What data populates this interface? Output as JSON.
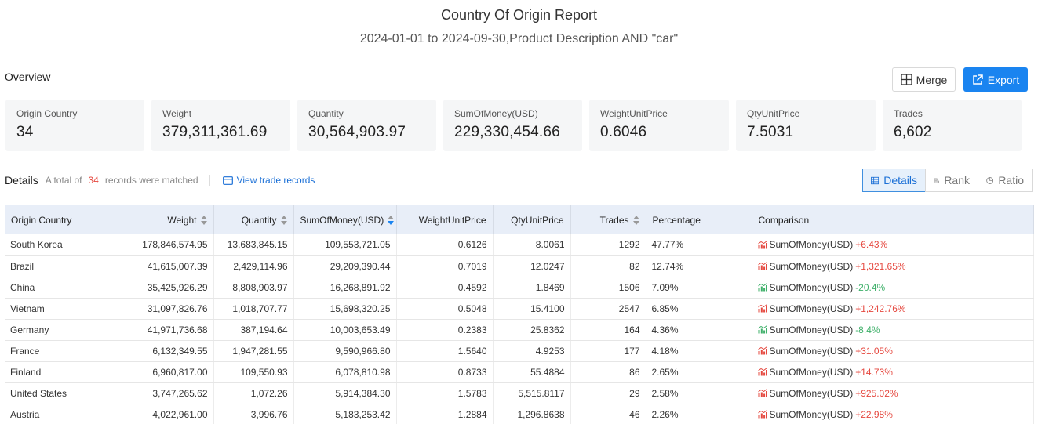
{
  "header": {
    "title": "Country Of Origin Report",
    "subtitle": "2024-01-01 to 2024-09-30,Product Description AND \"car\""
  },
  "overview": {
    "label": "Overview",
    "merge_label": "Merge",
    "export_label": "Export",
    "stats": [
      {
        "label": "Origin Country",
        "value": "34"
      },
      {
        "label": "Weight",
        "value": "379,311,361.69"
      },
      {
        "label": "Quantity",
        "value": "30,564,903.97"
      },
      {
        "label": "SumOfMoney(USD)",
        "value": "229,330,454.66"
      },
      {
        "label": "WeightUnitPrice",
        "value": "0.6046"
      },
      {
        "label": "QtyUnitPrice",
        "value": "7.5031"
      },
      {
        "label": "Trades",
        "value": "6,602"
      }
    ]
  },
  "details": {
    "title": "Details",
    "info_prefix": "A total of",
    "count": "34",
    "info_suffix": "records were matched",
    "view_trade": "View trade records",
    "views": [
      "Details",
      "Rank",
      "Ratio"
    ],
    "active_view": "Details"
  },
  "table": {
    "headers": [
      "Origin Country",
      "Weight",
      "Quantity",
      "SumOfMoney(USD)",
      "WeightUnitPrice",
      "QtyUnitPrice",
      "Trades",
      "Percentage",
      "Comparison"
    ],
    "comparison_label": "SumOfMoney(USD)",
    "rows": [
      {
        "country": "South Korea",
        "weight": "178,846,574.95",
        "quantity": "13,683,845.15",
        "money": "109,553,721.05",
        "wup": "0.6126",
        "qup": "8.0061",
        "trades": "1292",
        "pct": "47.77%",
        "change": "+6.43%",
        "dir": "up"
      },
      {
        "country": "Brazil",
        "weight": "41,615,007.39",
        "quantity": "2,429,114.96",
        "money": "29,209,390.44",
        "wup": "0.7019",
        "qup": "12.0247",
        "trades": "82",
        "pct": "12.74%",
        "change": "+1,321.65%",
        "dir": "up"
      },
      {
        "country": "China",
        "weight": "35,425,926.29",
        "quantity": "8,808,903.97",
        "money": "16,268,891.92",
        "wup": "0.4592",
        "qup": "1.8469",
        "trades": "1506",
        "pct": "7.09%",
        "change": "-20.4%",
        "dir": "down"
      },
      {
        "country": "Vietnam",
        "weight": "31,097,826.76",
        "quantity": "1,018,707.77",
        "money": "15,698,320.25",
        "wup": "0.5048",
        "qup": "15.4100",
        "trades": "2547",
        "pct": "6.85%",
        "change": "+1,242.76%",
        "dir": "up"
      },
      {
        "country": "Germany",
        "weight": "41,971,736.68",
        "quantity": "387,194.64",
        "money": "10,003,653.49",
        "wup": "0.2383",
        "qup": "25.8362",
        "trades": "164",
        "pct": "4.36%",
        "change": "-8.4%",
        "dir": "down"
      },
      {
        "country": "France",
        "weight": "6,132,349.55",
        "quantity": "1,947,281.55",
        "money": "9,590,966.80",
        "wup": "1.5640",
        "qup": "4.9253",
        "trades": "177",
        "pct": "4.18%",
        "change": "+31.05%",
        "dir": "up"
      },
      {
        "country": "Finland",
        "weight": "6,960,817.00",
        "quantity": "109,550.93",
        "money": "6,078,810.98",
        "wup": "0.8733",
        "qup": "55.4884",
        "trades": "86",
        "pct": "2.65%",
        "change": "+14.73%",
        "dir": "up"
      },
      {
        "country": "United States",
        "weight": "3,747,265.62",
        "quantity": "1,072.26",
        "money": "5,914,384.30",
        "wup": "1.5783",
        "qup": "5,515.8117",
        "trades": "29",
        "pct": "2.58%",
        "change": "+925.02%",
        "dir": "up"
      },
      {
        "country": "Austria",
        "weight": "4,022,961.00",
        "quantity": "3,996.76",
        "money": "5,183,253.42",
        "wup": "1.2884",
        "qup": "1,296.8638",
        "trades": "46",
        "pct": "2.26%",
        "change": "+22.98%",
        "dir": "up"
      }
    ]
  },
  "colors": {
    "accent": "#1a84f0",
    "up": "#e5483f",
    "down": "#3fb06a",
    "header_bg": "#e8eef8",
    "stat_bg": "#f5f6f7"
  }
}
